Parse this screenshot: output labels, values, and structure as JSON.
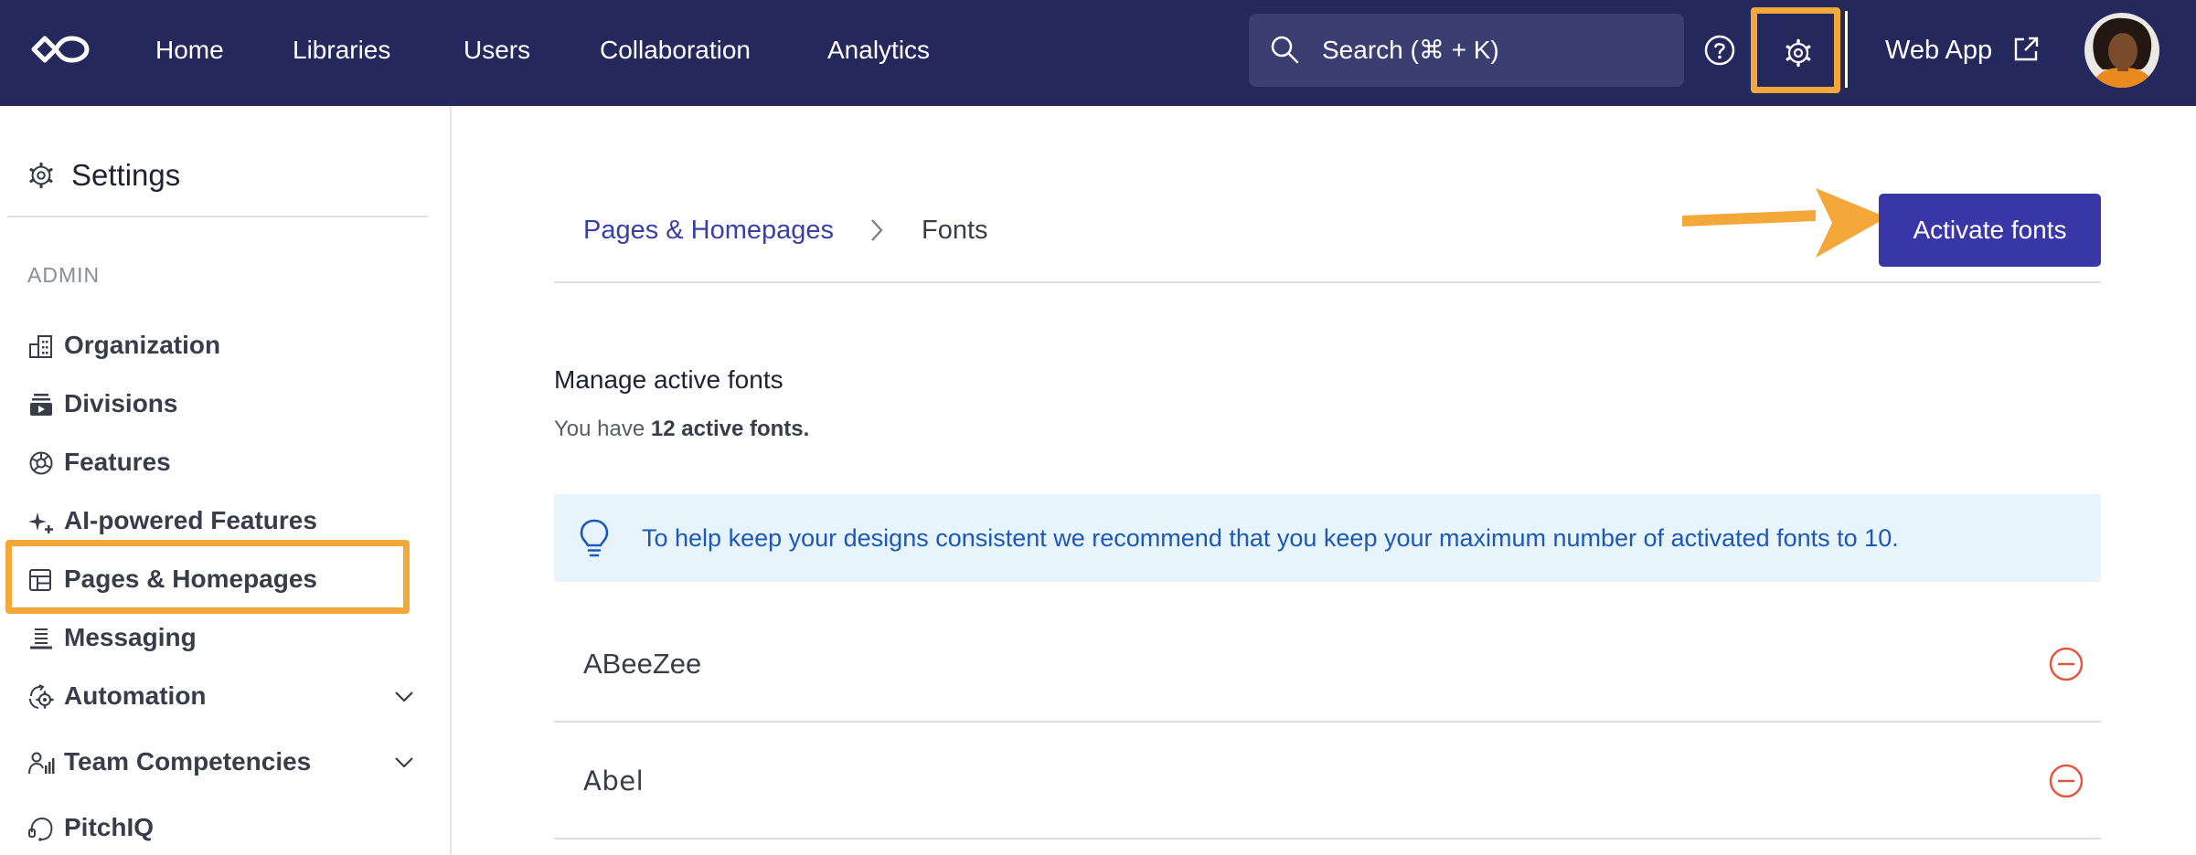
{
  "topnav": {
    "links": [
      "Home",
      "Libraries",
      "Users",
      "Collaboration",
      "Analytics"
    ],
    "search_label": "Search (⌘ + K)",
    "webapp_label": "Web App"
  },
  "sidebar": {
    "title": "Settings",
    "section_label": "ADMIN",
    "items": [
      {
        "label": "Organization",
        "icon": "building-icon"
      },
      {
        "label": "Divisions",
        "icon": "divisions-icon"
      },
      {
        "label": "Features",
        "icon": "aperture-icon"
      },
      {
        "label": "AI-powered Features",
        "icon": "sparkle-plus-icon"
      },
      {
        "label": "Pages & Homepages",
        "icon": "layout-icon"
      },
      {
        "label": "Messaging",
        "icon": "messaging-icon"
      },
      {
        "label": "Automation",
        "icon": "automation-icon"
      },
      {
        "label": "Team Competencies",
        "icon": "team-icon"
      },
      {
        "label": "PitchIQ",
        "icon": "headset-icon"
      }
    ]
  },
  "breadcrumb": {
    "parent": "Pages & Homepages",
    "current": "Fonts"
  },
  "main": {
    "activate_button": "Activate fonts",
    "manage_title": "Manage active fonts",
    "count_prefix": "You have ",
    "count_bold": "12 active fonts.",
    "tip": "To help keep your designs consistent we recommend that you keep your maximum number of activated fonts to 10.",
    "fonts": [
      "ABeeZee",
      "Abel"
    ]
  },
  "colors": {
    "nav_bg": "#24285c",
    "accent": "#3936a8",
    "highlight": "#f5a83a",
    "remove": "#e2553a",
    "tip_bg": "#e7f4fc"
  }
}
